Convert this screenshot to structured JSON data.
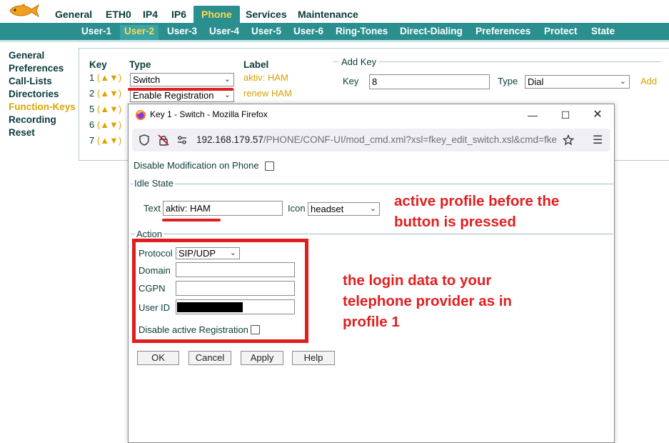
{
  "top_nav": {
    "tabs": [
      "General",
      "ETH0",
      "IP4",
      "IP6",
      "Phone",
      "Services",
      "Maintenance"
    ],
    "active": "Phone"
  },
  "sub_nav": {
    "tabs": [
      "User-1",
      "User-2",
      "User-3",
      "User-4",
      "User-5",
      "User-6",
      "Ring-Tones",
      "Direct-Dialing",
      "Preferences",
      "Protect",
      "State"
    ],
    "active": "User-2"
  },
  "left_menu": {
    "items": [
      "General",
      "Preferences",
      "Call-Lists",
      "Directories",
      "Function-Keys",
      "Recording",
      "Reset"
    ],
    "active": "Function-Keys"
  },
  "keys_table": {
    "headers": {
      "key": "Key",
      "type": "Type",
      "label": "Label"
    },
    "arrows": "(▲▼)",
    "rows": [
      {
        "key": "1",
        "type": "Switch",
        "label": "aktiv: HAM"
      },
      {
        "key": "2",
        "type": "Enable Registration",
        "label": "renew HAM"
      },
      {
        "key": "5"
      },
      {
        "key": "6"
      },
      {
        "key": "7"
      }
    ]
  },
  "add_key": {
    "legend": "Add Key",
    "key_label": "Key",
    "key_value": "8",
    "type_label": "Type",
    "type_value": "Dial",
    "add_link": "Add"
  },
  "popup": {
    "title": "Key 1 - Switch - Mozilla Firefox",
    "url_host": "192.168.179.57",
    "url_path": "/PHONE/CONF-UI/mod_cmd.xml?xsl=fkey_edit_switch.xsl&cmd=fke",
    "disable_modification": "Disable Modification on Phone",
    "idle_state": {
      "legend": "Idle State",
      "text_label": "Text",
      "text_value": "aktiv: HAM",
      "icon_label": "Icon",
      "icon_value": "headset"
    },
    "action": {
      "legend": "Action",
      "protocol_label": "Protocol",
      "protocol_value": "SIP/UDP",
      "domain_label": "Domain",
      "cgpn_label": "CGPN",
      "userid_label": "User ID",
      "disable_reg_label": "Disable active Registration"
    },
    "buttons": {
      "ok": "OK",
      "cancel": "Cancel",
      "apply": "Apply",
      "help": "Help"
    }
  },
  "annotations": {
    "idle_note_line1": "active profile before the",
    "idle_note_line2": "button is pressed",
    "action_note_line1": "the login data to your",
    "action_note_line2": "telephone provider as in",
    "action_note_line3": "profile 1"
  },
  "colors": {
    "nav_teal": "#2b8f8f",
    "active_yellow": "#ffd84a",
    "annotation_red": "#e01e1e",
    "dark_teal_text": "#0b3b3b"
  }
}
